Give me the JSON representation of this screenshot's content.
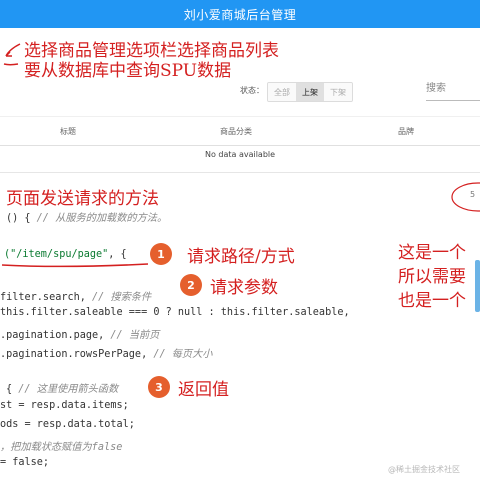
{
  "app": {
    "title": "刘小爱商城后台管理",
    "accent": "#2196f3"
  },
  "annotations": {
    "top_line1": "选择商品管理选项栏选择商品列表",
    "top_line2": "要从数据库中查询SPU数据",
    "section_title": "页面发送请求的方法",
    "side_line1": "这是一个",
    "side_line2": "所以需要",
    "side_line3": "也是一个",
    "color": "#d42020"
  },
  "toolbar": {
    "status_label": "状态：",
    "filters": [
      "全部",
      "上架",
      "下架"
    ],
    "selected_filter": "上架",
    "search_label": "搜索"
  },
  "table": {
    "columns": [
      "标题",
      "商品分类",
      "品牌"
    ],
    "empty_text": "No data available"
  },
  "steps": [
    {
      "num": "1",
      "label": "请求路径/方式"
    },
    {
      "num": "2",
      "label": "请求参数"
    },
    {
      "num": "3",
      "label": "返回值"
    }
  ],
  "code": {
    "line1_a": "() { ",
    "line1_cmt": "// 从服务的加载数的方法。",
    "line2_str": "(\"/item/spu/page\"",
    "line2_b": ", {",
    "line3_a": "filter.search, ",
    "line3_cmt": "// 搜索条件",
    "line4_a": "this.filter.saleable === 0 ? null : this.filter.saleable,",
    "line5_a": ".pagination.page, ",
    "line5_cmt": "// 当前页",
    "line6_a": ".pagination.rowsPerPage, ",
    "line6_cmt": "// 每页大小",
    "line7_a": "{ ",
    "line7_cmt": "// 这里使用箭头函数",
    "line8_a": "st = resp.data.items;",
    "line9_a": "ods = resp.data.total;",
    "line10_cmt": "，把加载状态赋值为false",
    "line11_a": "= false;"
  },
  "watermark": "@稀土掘金技术社区",
  "side_circle_text": "5"
}
